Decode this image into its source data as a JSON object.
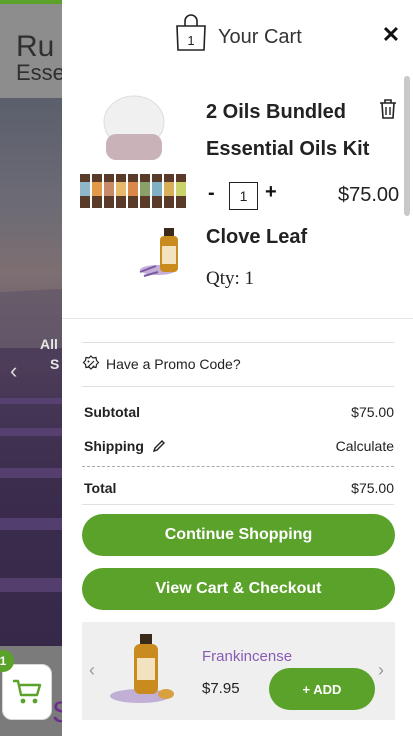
{
  "background": {
    "logo_line1": "Ru",
    "logo_line2": "Esse",
    "hero_text_1": "All",
    "hero_text_2": "S",
    "bottom_text": "Si",
    "cart_count": "1"
  },
  "cart": {
    "title": "Your Cart",
    "bag_count": "1",
    "close_label": "✕",
    "items": [
      {
        "name": "2 Oils Bundled Essential Oils Kit",
        "qty_minus": "-",
        "qty": "1",
        "qty_plus": "+",
        "price": "$75.00"
      },
      {
        "name": "Clove Leaf",
        "qty_text": "Qty: 1"
      }
    ],
    "promo": "Have a Promo Code?",
    "summary": {
      "subtotal_label": "Subtotal",
      "subtotal_value": "$75.00",
      "shipping_label": "Shipping",
      "shipping_value": "Calculate",
      "total_label": "Total",
      "total_value": "$75.00"
    },
    "continue_button": "Continue Shopping",
    "checkout_button": "View Cart & Checkout",
    "upsell": {
      "name": "Frankincense",
      "price": "$7.95",
      "add_label": "+ ADD",
      "prev": "‹",
      "next": "›"
    }
  },
  "colors": {
    "accent_green": "#5aa22a",
    "product_purple": "#8a5bb5"
  }
}
